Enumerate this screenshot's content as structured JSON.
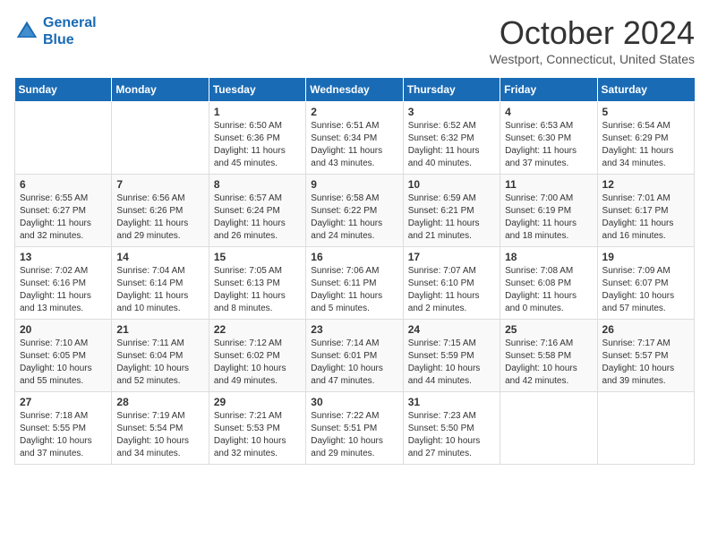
{
  "header": {
    "logo_line1": "General",
    "logo_line2": "Blue",
    "month": "October 2024",
    "location": "Westport, Connecticut, United States"
  },
  "days_of_week": [
    "Sunday",
    "Monday",
    "Tuesday",
    "Wednesday",
    "Thursday",
    "Friday",
    "Saturday"
  ],
  "weeks": [
    [
      {
        "day": "",
        "info": ""
      },
      {
        "day": "",
        "info": ""
      },
      {
        "day": "1",
        "info": "Sunrise: 6:50 AM\nSunset: 6:36 PM\nDaylight: 11 hours and 45 minutes."
      },
      {
        "day": "2",
        "info": "Sunrise: 6:51 AM\nSunset: 6:34 PM\nDaylight: 11 hours and 43 minutes."
      },
      {
        "day": "3",
        "info": "Sunrise: 6:52 AM\nSunset: 6:32 PM\nDaylight: 11 hours and 40 minutes."
      },
      {
        "day": "4",
        "info": "Sunrise: 6:53 AM\nSunset: 6:30 PM\nDaylight: 11 hours and 37 minutes."
      },
      {
        "day": "5",
        "info": "Sunrise: 6:54 AM\nSunset: 6:29 PM\nDaylight: 11 hours and 34 minutes."
      }
    ],
    [
      {
        "day": "6",
        "info": "Sunrise: 6:55 AM\nSunset: 6:27 PM\nDaylight: 11 hours and 32 minutes."
      },
      {
        "day": "7",
        "info": "Sunrise: 6:56 AM\nSunset: 6:26 PM\nDaylight: 11 hours and 29 minutes."
      },
      {
        "day": "8",
        "info": "Sunrise: 6:57 AM\nSunset: 6:24 PM\nDaylight: 11 hours and 26 minutes."
      },
      {
        "day": "9",
        "info": "Sunrise: 6:58 AM\nSunset: 6:22 PM\nDaylight: 11 hours and 24 minutes."
      },
      {
        "day": "10",
        "info": "Sunrise: 6:59 AM\nSunset: 6:21 PM\nDaylight: 11 hours and 21 minutes."
      },
      {
        "day": "11",
        "info": "Sunrise: 7:00 AM\nSunset: 6:19 PM\nDaylight: 11 hours and 18 minutes."
      },
      {
        "day": "12",
        "info": "Sunrise: 7:01 AM\nSunset: 6:17 PM\nDaylight: 11 hours and 16 minutes."
      }
    ],
    [
      {
        "day": "13",
        "info": "Sunrise: 7:02 AM\nSunset: 6:16 PM\nDaylight: 11 hours and 13 minutes."
      },
      {
        "day": "14",
        "info": "Sunrise: 7:04 AM\nSunset: 6:14 PM\nDaylight: 11 hours and 10 minutes."
      },
      {
        "day": "15",
        "info": "Sunrise: 7:05 AM\nSunset: 6:13 PM\nDaylight: 11 hours and 8 minutes."
      },
      {
        "day": "16",
        "info": "Sunrise: 7:06 AM\nSunset: 6:11 PM\nDaylight: 11 hours and 5 minutes."
      },
      {
        "day": "17",
        "info": "Sunrise: 7:07 AM\nSunset: 6:10 PM\nDaylight: 11 hours and 2 minutes."
      },
      {
        "day": "18",
        "info": "Sunrise: 7:08 AM\nSunset: 6:08 PM\nDaylight: 11 hours and 0 minutes."
      },
      {
        "day": "19",
        "info": "Sunrise: 7:09 AM\nSunset: 6:07 PM\nDaylight: 10 hours and 57 minutes."
      }
    ],
    [
      {
        "day": "20",
        "info": "Sunrise: 7:10 AM\nSunset: 6:05 PM\nDaylight: 10 hours and 55 minutes."
      },
      {
        "day": "21",
        "info": "Sunrise: 7:11 AM\nSunset: 6:04 PM\nDaylight: 10 hours and 52 minutes."
      },
      {
        "day": "22",
        "info": "Sunrise: 7:12 AM\nSunset: 6:02 PM\nDaylight: 10 hours and 49 minutes."
      },
      {
        "day": "23",
        "info": "Sunrise: 7:14 AM\nSunset: 6:01 PM\nDaylight: 10 hours and 47 minutes."
      },
      {
        "day": "24",
        "info": "Sunrise: 7:15 AM\nSunset: 5:59 PM\nDaylight: 10 hours and 44 minutes."
      },
      {
        "day": "25",
        "info": "Sunrise: 7:16 AM\nSunset: 5:58 PM\nDaylight: 10 hours and 42 minutes."
      },
      {
        "day": "26",
        "info": "Sunrise: 7:17 AM\nSunset: 5:57 PM\nDaylight: 10 hours and 39 minutes."
      }
    ],
    [
      {
        "day": "27",
        "info": "Sunrise: 7:18 AM\nSunset: 5:55 PM\nDaylight: 10 hours and 37 minutes."
      },
      {
        "day": "28",
        "info": "Sunrise: 7:19 AM\nSunset: 5:54 PM\nDaylight: 10 hours and 34 minutes."
      },
      {
        "day": "29",
        "info": "Sunrise: 7:21 AM\nSunset: 5:53 PM\nDaylight: 10 hours and 32 minutes."
      },
      {
        "day": "30",
        "info": "Sunrise: 7:22 AM\nSunset: 5:51 PM\nDaylight: 10 hours and 29 minutes."
      },
      {
        "day": "31",
        "info": "Sunrise: 7:23 AM\nSunset: 5:50 PM\nDaylight: 10 hours and 27 minutes."
      },
      {
        "day": "",
        "info": ""
      },
      {
        "day": "",
        "info": ""
      }
    ]
  ]
}
